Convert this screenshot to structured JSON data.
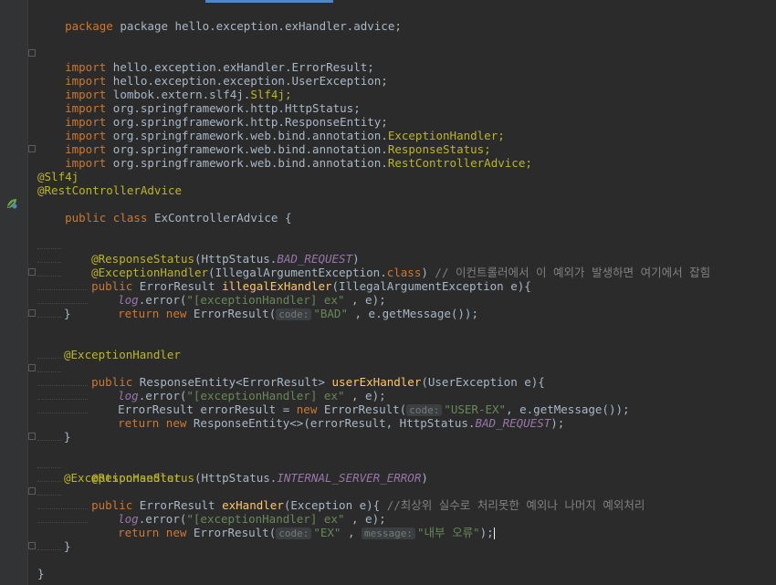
{
  "lines": {
    "l01": "package hello.exception.exHandler.advice;",
    "l03": "hello.exception.exHandler.ErrorResult;",
    "l04": "hello.exception.exception.UserException;",
    "l05": "lombok.extern.slf4j.",
    "l05b": "Slf4j;",
    "l06": "org.springframework.http.HttpStatus;",
    "l07": "org.springframework.http.ResponseEntity;",
    "l08a": "org.springframework.web.bind.annotation.",
    "l08b": "ExceptionHandler;",
    "l09b": "ResponseStatus;",
    "l10b": "RestControllerAdvice;",
    "ann_slf4j": "@Slf4j",
    "ann_rca": "@RestControllerAdvice",
    "class_decl": "ExControllerAdvice {",
    "m1_ann1": "@ResponseStatus",
    "m1_ann1_args": "(HttpStatus.",
    "bad_request": "BAD_REQUEST",
    "m1_ann2": "@ExceptionHandler",
    "m1_ann2_args": "(IllegalArgumentException.",
    "m1_ann2_end": ")",
    "m1_comment": "// 이컨트롤러에서 이 예외가 발생하면 여기에서 잡힘",
    "m1_sig_ret": "ErrorResult ",
    "m1_name": "illegalExHandler",
    "m1_params": "(IllegalArgumentException e){",
    "log": "log",
    "log_error": ".error(",
    "log_str": "\"[exceptionHandler] ex\"",
    "log_end": " , e);",
    "m1_ret_new": "ErrorResult(",
    "hint_code": "code:",
    "m1_bad": "\"BAD\"",
    "m1_ret_end": " , e.getMessage());",
    "m2_ann": "@ExceptionHandler",
    "m2_sig_ret": "ResponseEntity<ErrorResult> ",
    "m2_name": "userExHandler",
    "m2_params": "(UserException e){",
    "m2_decl": "ErrorResult errorResult = ",
    "m2_new": "ErrorResult(",
    "m2_user_ex": "\"USER-EX\"",
    "m2_decl_end": ", e.getMessage());",
    "m2_ret": "ResponseEntity<>(errorResult, HttpStatus.",
    "m2_ret_end": ");",
    "m3_ann1_args": "(HttpStatus.",
    "internal_error": "INTERNAL_SERVER_ERROR",
    "m3_name": "exHandler",
    "m3_params": "(Exception e){ ",
    "m3_comment": "//최상위 실수로 처리못한 예외나 나머지 예외처리",
    "m3_ex": "\"EX\"",
    "hint_message": "message:",
    "m3_msg": "\"내부 오류\"",
    "m3_end": ");",
    "brace": "}",
    "kw_package": "package",
    "kw_import": "import",
    "kw_public": "public",
    "kw_class": "class",
    "kw_return": "return",
    "kw_new": "new",
    "kw_class_lit": "class"
  },
  "colors": {
    "background": "#2b2b2b",
    "keyword": "#cc7832",
    "annotation": "#bbb529",
    "string": "#6a8759",
    "method": "#ffc66d",
    "field": "#9876aa",
    "comment": "#808080"
  },
  "icons": {
    "gutter": "spring-bean-icon"
  }
}
